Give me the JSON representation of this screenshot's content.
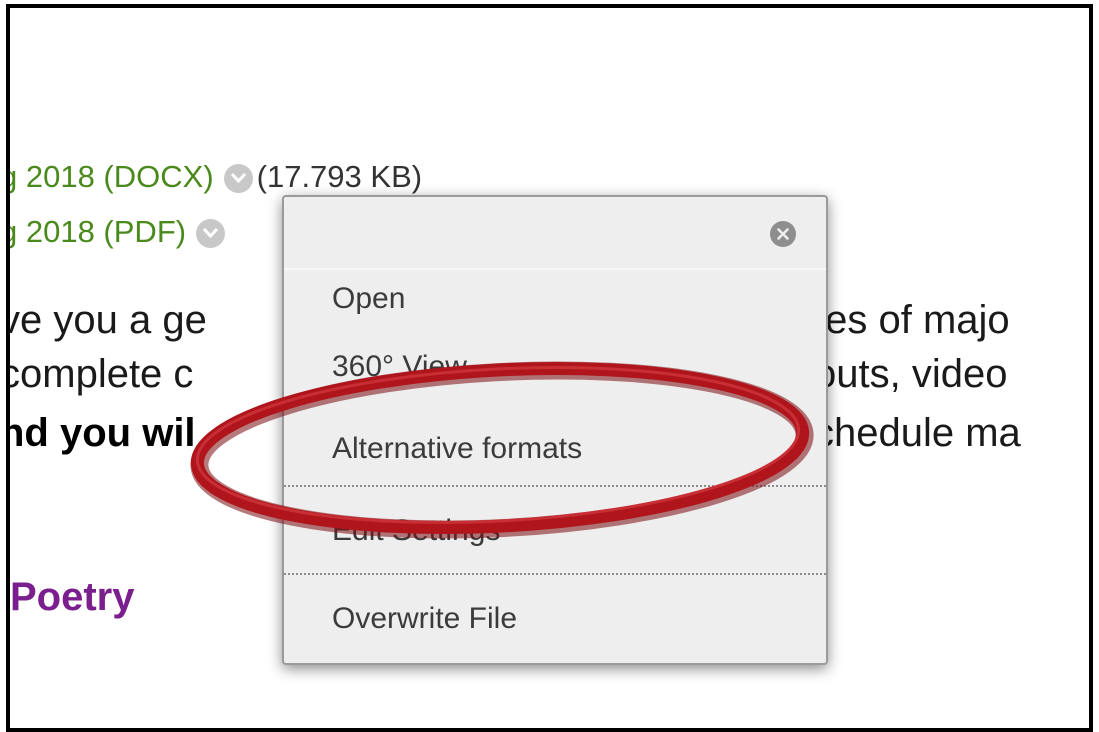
{
  "files": [
    {
      "link": "g 2018 (DOCX)",
      "size": "(17.793 KB)"
    },
    {
      "link": "g 2018 (PDF)",
      "size": ""
    }
  ],
  "body_lines": [
    {
      "left": "ve you a ge",
      "right": "tes of majo"
    },
    {
      "left": " complete c",
      "right": "outs, video"
    },
    {
      "left": "nd you wil",
      "right": "chedule ma"
    }
  ],
  "section_heading": "Poetry",
  "menu": {
    "items": [
      {
        "label": "Open"
      },
      {
        "label": "360° View"
      },
      {
        "label": "Alternative formats"
      },
      {
        "label": "Edit Settings"
      },
      {
        "label": "Overwrite File"
      }
    ]
  },
  "colors": {
    "file_link": "#4a8a1c",
    "heading": "#7b1f8f",
    "annotation": "#b0151c"
  }
}
